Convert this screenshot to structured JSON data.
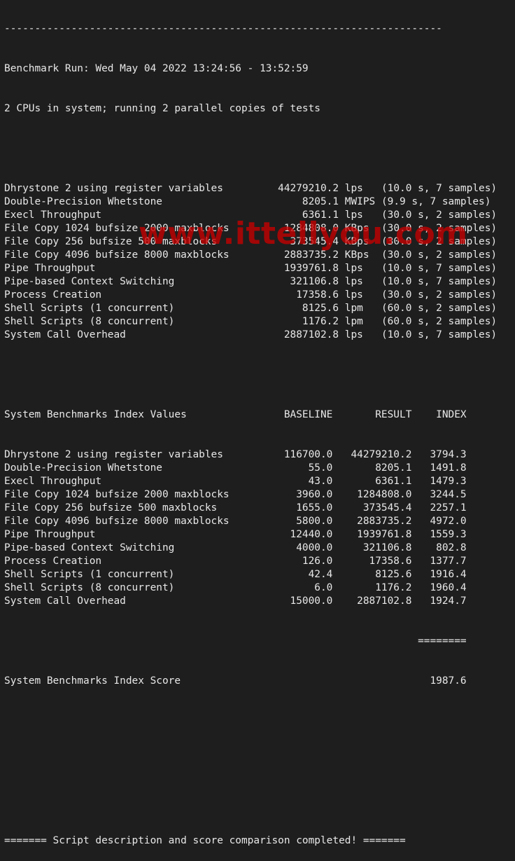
{
  "terminal": {
    "separator_top": "------------------------------------------------------------------------",
    "run_header": "Benchmark Run: Wed May 04 2022 13:24:56 - 13:52:59",
    "cpu_info": "2 CPUs in system; running 2 parallel copies of tests",
    "raw_results": [
      {
        "name": "Dhrystone 2 using register variables",
        "value": "44279210.2",
        "unit": "lps",
        "detail": "(10.0 s, 7 samples)"
      },
      {
        "name": "Double-Precision Whetstone",
        "value": "8205.1",
        "unit": "MWIPS",
        "detail": "(9.9 s, 7 samples)"
      },
      {
        "name": "Execl Throughput",
        "value": "6361.1",
        "unit": "lps",
        "detail": "(30.0 s, 2 samples)"
      },
      {
        "name": "File Copy 1024 bufsize 2000 maxblocks",
        "value": "1284808.0",
        "unit": "KBps",
        "detail": "(30.0 s, 2 samples)"
      },
      {
        "name": "File Copy 256 bufsize 500 maxblocks",
        "value": "373545.4",
        "unit": "KBps",
        "detail": "(30.0 s, 2 samples)"
      },
      {
        "name": "File Copy 4096 bufsize 8000 maxblocks",
        "value": "2883735.2",
        "unit": "KBps",
        "detail": "(30.0 s, 2 samples)"
      },
      {
        "name": "Pipe Throughput",
        "value": "1939761.8",
        "unit": "lps",
        "detail": "(10.0 s, 7 samples)"
      },
      {
        "name": "Pipe-based Context Switching",
        "value": "321106.8",
        "unit": "lps",
        "detail": "(10.0 s, 7 samples)"
      },
      {
        "name": "Process Creation",
        "value": "17358.6",
        "unit": "lps",
        "detail": "(30.0 s, 2 samples)"
      },
      {
        "name": "Shell Scripts (1 concurrent)",
        "value": "8125.6",
        "unit": "lpm",
        "detail": "(60.0 s, 2 samples)"
      },
      {
        "name": "Shell Scripts (8 concurrent)",
        "value": "1176.2",
        "unit": "lpm",
        "detail": "(60.0 s, 2 samples)"
      },
      {
        "name": "System Call Overhead",
        "value": "2887102.8",
        "unit": "lps",
        "detail": "(10.0 s, 7 samples)"
      }
    ],
    "index_header": {
      "title": "System Benchmarks Index Values",
      "baseline": "BASELINE",
      "result": "RESULT",
      "index": "INDEX"
    },
    "index_rows": [
      {
        "name": "Dhrystone 2 using register variables",
        "baseline": "116700.0",
        "result": "44279210.2",
        "index": "3794.3"
      },
      {
        "name": "Double-Precision Whetstone",
        "baseline": "55.0",
        "result": "8205.1",
        "index": "1491.8"
      },
      {
        "name": "Execl Throughput",
        "baseline": "43.0",
        "result": "6361.1",
        "index": "1479.3"
      },
      {
        "name": "File Copy 1024 bufsize 2000 maxblocks",
        "baseline": "3960.0",
        "result": "1284808.0",
        "index": "3244.5"
      },
      {
        "name": "File Copy 256 bufsize 500 maxblocks",
        "baseline": "1655.0",
        "result": "373545.4",
        "index": "2257.1"
      },
      {
        "name": "File Copy 4096 bufsize 8000 maxblocks",
        "baseline": "5800.0",
        "result": "2883735.2",
        "index": "4972.0"
      },
      {
        "name": "Pipe Throughput",
        "baseline": "12440.0",
        "result": "1939761.8",
        "index": "1559.3"
      },
      {
        "name": "Pipe-based Context Switching",
        "baseline": "4000.0",
        "result": "321106.8",
        "index": "802.8"
      },
      {
        "name": "Process Creation",
        "baseline": "126.0",
        "result": "17358.6",
        "index": "1377.7"
      },
      {
        "name": "Shell Scripts (1 concurrent)",
        "baseline": "42.4",
        "result": "8125.6",
        "index": "1916.4"
      },
      {
        "name": "Shell Scripts (8 concurrent)",
        "baseline": "6.0",
        "result": "1176.2",
        "index": "1960.4"
      },
      {
        "name": "System Call Overhead",
        "baseline": "15000.0",
        "result": "2887102.8",
        "index": "1924.7"
      }
    ],
    "index_separator": "========",
    "score_label": "System Benchmarks Index Score",
    "score_value": "1987.6",
    "footer": "======= Script description and score comparison completed! ======="
  },
  "watermark": {
    "text": "www.ittellyou.com"
  },
  "colors": {
    "background": "#1e1e1e",
    "foreground": "#e8e8e8",
    "watermark": "#c80000"
  }
}
